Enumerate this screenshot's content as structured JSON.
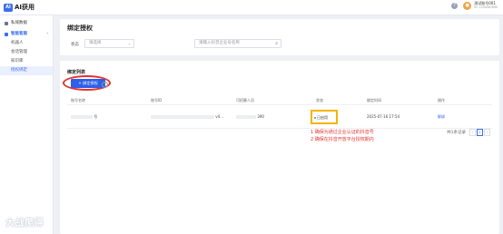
{
  "app": {
    "logo_text": "AI获用",
    "logo_mark": "AI"
  },
  "top": {
    "help": "?",
    "user_name": "测试账号001",
    "user_sub": "ID: 1234567890"
  },
  "sidebar": {
    "items": [
      {
        "label": "私域数据",
        "type": "item"
      },
      {
        "label": "智能客服",
        "type": "group"
      },
      {
        "label": "机器人",
        "type": "sub"
      },
      {
        "label": "会话管理",
        "type": "sub"
      },
      {
        "label": "知识库",
        "type": "sub"
      },
      {
        "label": "授权绑定",
        "type": "sub",
        "active": true
      }
    ]
  },
  "header": {
    "title": "绑定授权",
    "status_label": "状态",
    "status_placeholder": "请选择",
    "search_placeholder": "请输入抖音企业号名称"
  },
  "main": {
    "list_title": "绑定列表",
    "bind_button": "+ 绑定授权",
    "columns": [
      "账号名称",
      "账号ID",
      "可招募人员",
      "状态",
      "绑定时间",
      "操作"
    ],
    "rows": [
      {
        "name_suffix": "号",
        "id_suffix": "v4...",
        "recruit_suffix": "390",
        "status": "已启用",
        "bind_time": "2025-07-16 17:54",
        "action": "解绑"
      }
    ],
    "notes": [
      "1 确保为通过企业认证的抖音号",
      "2 确保在抖音开放平台授权期内"
    ],
    "pager": {
      "total": "共1条记录",
      "prev": "‹",
      "page": "1",
      "next": "›"
    }
  },
  "watermark": "大战爬得",
  "colors": {
    "accent": "#3a6df0",
    "annotation": "#e3342f",
    "highlight": "#f5b400",
    "status_ok": "#30b46c"
  }
}
